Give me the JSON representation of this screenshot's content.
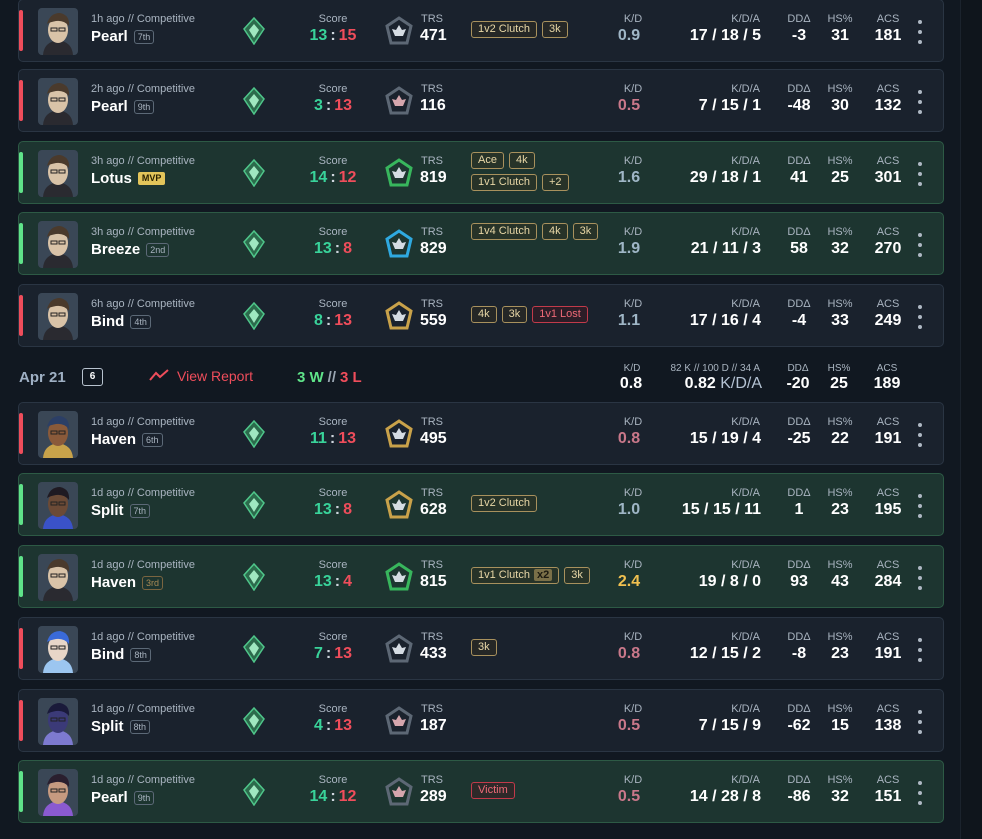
{
  "captions": {
    "score": "Score",
    "trs": "TRS",
    "kd": "K/D",
    "kda": "K/D/A",
    "dd": "DDΔ",
    "hs": "HS%",
    "acs": "ACS"
  },
  "colors": {
    "win_accent": "#5fe389",
    "loss_accent": "#ef4d5b",
    "score_win": "#39d39a",
    "score_loss": "#ef4d5b",
    "kd_great": "#f0c050"
  },
  "matches_group1": [
    {
      "time": "1h ago // Competitive",
      "map": "Pearl",
      "placement": "7th",
      "result": "loss",
      "agent_icon": "agent-chamber-icon",
      "score_team": "13",
      "score_enemy": "15",
      "trs_icon": "trs-rank-icon-gray",
      "trs": "471",
      "badges": [
        "1v2 Clutch",
        "3k"
      ],
      "kd": "0.9",
      "kda": "17 / 18 / 5",
      "dd": "-3",
      "hs": "31",
      "acs": "181"
    },
    {
      "time": "2h ago // Competitive",
      "map": "Pearl",
      "placement": "9th",
      "result": "loss",
      "agent_icon": "agent-chamber-icon",
      "score_team": "3",
      "score_enemy": "13",
      "trs_icon": "trs-rank-icon-pink",
      "trs": "116",
      "badges": [],
      "kd": "0.5",
      "kda": "7 / 15 / 1",
      "dd": "-48",
      "hs": "30",
      "acs": "132"
    },
    {
      "time": "3h ago // Competitive",
      "map": "Lotus",
      "placement": "MVP",
      "result": "win",
      "agent_icon": "agent-chamber-icon",
      "score_team": "14",
      "score_enemy": "12",
      "trs_icon": "trs-rank-icon-green",
      "trs": "819",
      "badges": [
        "Ace",
        "4k",
        "1v1 Clutch",
        "+2"
      ],
      "kd": "1.6",
      "kda": "29 / 18 / 1",
      "dd": "41",
      "hs": "25",
      "acs": "301"
    },
    {
      "time": "3h ago // Competitive",
      "map": "Breeze",
      "placement": "2nd",
      "result": "win",
      "agent_icon": "agent-chamber-icon",
      "score_team": "13",
      "score_enemy": "8",
      "trs_icon": "trs-rank-icon-blue",
      "trs": "829",
      "badges": [
        "1v4 Clutch",
        "4k",
        "3k"
      ],
      "kd": "1.9",
      "kda": "21 / 11 / 3",
      "dd": "58",
      "hs": "32",
      "acs": "270"
    },
    {
      "time": "6h ago // Competitive",
      "map": "Bind",
      "placement": "4th",
      "result": "loss",
      "agent_icon": "agent-chamber-icon",
      "score_team": "8",
      "score_enemy": "13",
      "trs_icon": "trs-rank-icon-gold",
      "trs": "559",
      "badges": [
        "4k",
        "3k",
        "1v1 Lost"
      ],
      "kd": "1.1",
      "kda": "17 / 16 / 4",
      "dd": "-4",
      "hs": "33",
      "acs": "249"
    }
  ],
  "day_header": {
    "date": "Apr 21",
    "count": "6",
    "view_report": "View Report",
    "wins": "3 W",
    "sep": "//",
    "losses": "3 L",
    "kd_caption": "K/D",
    "kd": "0.8",
    "kda_caption": "82 K // 100 D // 34 A",
    "kda": "0.82",
    "kda_unit": "K/D/A",
    "dd_caption": "DDΔ",
    "dd": "-20",
    "hs_caption": "HS%",
    "hs": "25",
    "acs_caption": "ACS",
    "acs": "189"
  },
  "matches_group2": [
    {
      "time": "1d ago // Competitive",
      "map": "Haven",
      "placement": "6th",
      "result": "loss",
      "agent_icon": "agent-astra-icon",
      "score_team": "11",
      "score_enemy": "13",
      "trs_icon": "trs-rank-icon-gold",
      "trs": "495",
      "badges": [],
      "kd": "0.8",
      "kda": "15 / 19 / 4",
      "dd": "-25",
      "hs": "22",
      "acs": "191"
    },
    {
      "time": "1d ago // Competitive",
      "map": "Split",
      "placement": "7th",
      "result": "win",
      "agent_icon": "agent-neon-icon",
      "score_team": "13",
      "score_enemy": "8",
      "trs_icon": "trs-rank-icon-gold",
      "trs": "628",
      "badges": [
        "1v2 Clutch"
      ],
      "kd": "1.0",
      "kda": "15 / 15 / 11",
      "dd": "1",
      "hs": "23",
      "acs": "195"
    },
    {
      "time": "1d ago // Competitive",
      "map": "Haven",
      "placement": "3rd",
      "result": "win",
      "agent_icon": "agent-chamber-icon",
      "score_team": "13",
      "score_enemy": "4",
      "trs_icon": "trs-rank-icon-green",
      "trs": "815",
      "badges": [
        "1v1 Clutch|x2",
        "3k"
      ],
      "kd": "2.4",
      "kda": "19 / 8 / 0",
      "dd": "93",
      "hs": "43",
      "acs": "284"
    },
    {
      "time": "1d ago // Competitive",
      "map": "Bind",
      "placement": "8th",
      "result": "loss",
      "agent_icon": "agent-jett-icon",
      "score_team": "7",
      "score_enemy": "13",
      "trs_icon": "trs-rank-icon-gray",
      "trs": "433",
      "badges": [
        "3k"
      ],
      "kd": "0.8",
      "kda": "12 / 15 / 2",
      "dd": "-8",
      "hs": "23",
      "acs": "191"
    },
    {
      "time": "1d ago // Competitive",
      "map": "Split",
      "placement": "8th",
      "result": "loss",
      "agent_icon": "agent-omen-icon",
      "score_team": "4",
      "score_enemy": "13",
      "trs_icon": "trs-rank-icon-pink",
      "trs": "187",
      "badges": [],
      "kd": "0.5",
      "kda": "7 / 15 / 9",
      "dd": "-62",
      "hs": "15",
      "acs": "138"
    },
    {
      "time": "1d ago // Competitive",
      "map": "Pearl",
      "placement": "9th",
      "result": "win",
      "agent_icon": "agent-reyna-icon",
      "score_team": "14",
      "score_enemy": "12",
      "trs_icon": "trs-rank-icon-pink",
      "trs": "289",
      "badges": [
        "Victim"
      ],
      "kd": "0.5",
      "kda": "14 / 28 / 8",
      "dd": "-86",
      "hs": "32",
      "acs": "151"
    }
  ]
}
